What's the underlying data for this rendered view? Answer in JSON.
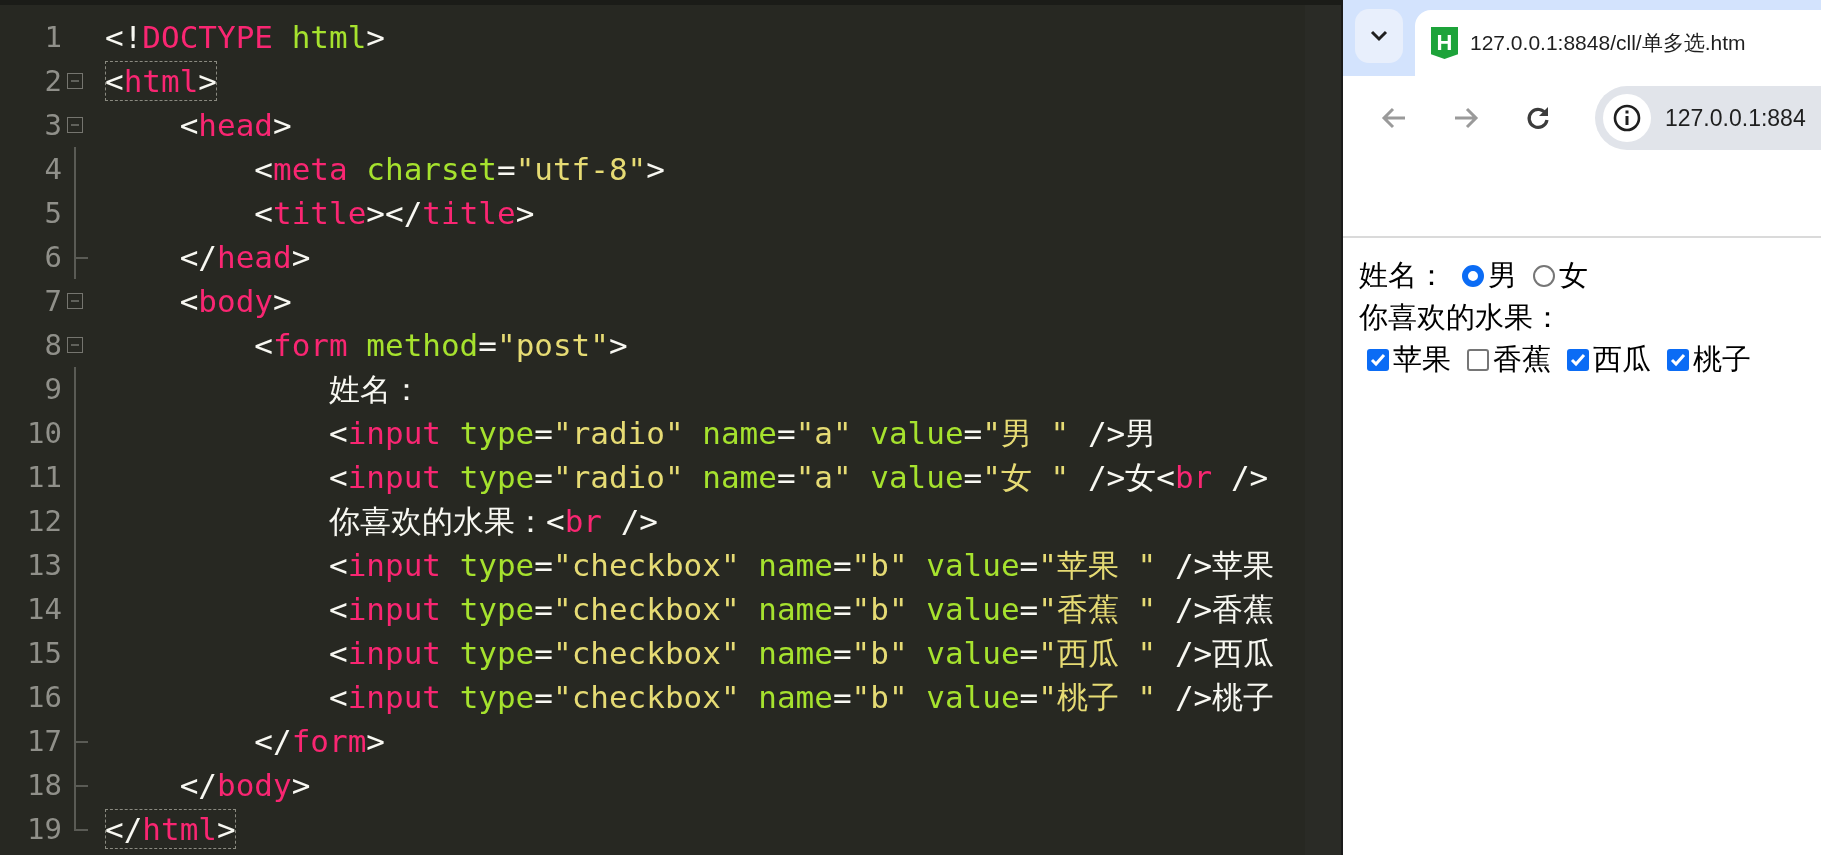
{
  "editor": {
    "lines": [
      {
        "number": "1",
        "kind": "none",
        "matched": false,
        "tokens": [
          {
            "t": "<!",
            "kind": "p"
          },
          {
            "t": "DOCTYPE",
            "kind": "tag"
          },
          {
            "t": " html",
            "kind": "attr"
          },
          {
            "t": ">",
            "kind": "p"
          }
        ]
      },
      {
        "number": "2",
        "kind": "open",
        "matched": true,
        "tokens": [
          {
            "t": "<",
            "kind": "p"
          },
          {
            "t": "html",
            "kind": "tag"
          },
          {
            "t": ">",
            "kind": "p"
          }
        ]
      },
      {
        "number": "3",
        "kind": "open",
        "matched": false,
        "tokens": [
          {
            "t": "    <",
            "kind": "p"
          },
          {
            "t": "head",
            "kind": "tag"
          },
          {
            "t": ">",
            "kind": "p"
          }
        ]
      },
      {
        "number": "4",
        "kind": "inside",
        "matched": false,
        "tokens": [
          {
            "t": "        <",
            "kind": "p"
          },
          {
            "t": "meta",
            "kind": "tag"
          },
          {
            "t": " charset",
            "kind": "attr"
          },
          {
            "t": "=",
            "kind": "p"
          },
          {
            "t": "\"utf-8\"",
            "kind": "str"
          },
          {
            "t": ">",
            "kind": "p"
          }
        ]
      },
      {
        "number": "5",
        "kind": "inside",
        "matched": false,
        "tokens": [
          {
            "t": "        <",
            "kind": "p"
          },
          {
            "t": "title",
            "kind": "tag"
          },
          {
            "t": "></",
            "kind": "p"
          },
          {
            "t": "title",
            "kind": "tag"
          },
          {
            "t": ">",
            "kind": "p"
          }
        ]
      },
      {
        "number": "6",
        "kind": "end",
        "matched": false,
        "tokens": [
          {
            "t": "    </",
            "kind": "p"
          },
          {
            "t": "head",
            "kind": "tag"
          },
          {
            "t": ">",
            "kind": "p"
          }
        ]
      },
      {
        "number": "7",
        "kind": "open",
        "matched": false,
        "tokens": [
          {
            "t": "    <",
            "kind": "p"
          },
          {
            "t": "body",
            "kind": "tag"
          },
          {
            "t": ">",
            "kind": "p"
          }
        ]
      },
      {
        "number": "8",
        "kind": "open",
        "matched": false,
        "tokens": [
          {
            "t": "        <",
            "kind": "p"
          },
          {
            "t": "form",
            "kind": "tag"
          },
          {
            "t": " method",
            "kind": "attr"
          },
          {
            "t": "=",
            "kind": "p"
          },
          {
            "t": "\"post\"",
            "kind": "str"
          },
          {
            "t": ">",
            "kind": "p"
          }
        ]
      },
      {
        "number": "9",
        "kind": "inside",
        "matched": false,
        "tokens": [
          {
            "t": "            姓名：",
            "kind": "p"
          }
        ]
      },
      {
        "number": "10",
        "kind": "inside",
        "matched": false,
        "tokens": [
          {
            "t": "            <",
            "kind": "p"
          },
          {
            "t": "input",
            "kind": "tag"
          },
          {
            "t": " type",
            "kind": "attr"
          },
          {
            "t": "=",
            "kind": "p"
          },
          {
            "t": "\"radio\"",
            "kind": "str"
          },
          {
            "t": " name",
            "kind": "attr"
          },
          {
            "t": "=",
            "kind": "p"
          },
          {
            "t": "\"a\"",
            "kind": "str"
          },
          {
            "t": " value",
            "kind": "attr"
          },
          {
            "t": "=",
            "kind": "p"
          },
          {
            "t": "\"男 \"",
            "kind": "str"
          },
          {
            "t": " />男",
            "kind": "p"
          }
        ]
      },
      {
        "number": "11",
        "kind": "inside",
        "matched": false,
        "tokens": [
          {
            "t": "            <",
            "kind": "p"
          },
          {
            "t": "input",
            "kind": "tag"
          },
          {
            "t": " type",
            "kind": "attr"
          },
          {
            "t": "=",
            "kind": "p"
          },
          {
            "t": "\"radio\"",
            "kind": "str"
          },
          {
            "t": " name",
            "kind": "attr"
          },
          {
            "t": "=",
            "kind": "p"
          },
          {
            "t": "\"a\"",
            "kind": "str"
          },
          {
            "t": " value",
            "kind": "attr"
          },
          {
            "t": "=",
            "kind": "p"
          },
          {
            "t": "\"女 \"",
            "kind": "str"
          },
          {
            "t": " />女<",
            "kind": "p"
          },
          {
            "t": "br",
            "kind": "tag"
          },
          {
            "t": " />",
            "kind": "p"
          }
        ]
      },
      {
        "number": "12",
        "kind": "inside",
        "matched": false,
        "tokens": [
          {
            "t": "            你喜欢的水果：<",
            "kind": "p"
          },
          {
            "t": "br",
            "kind": "tag"
          },
          {
            "t": " />",
            "kind": "p"
          }
        ]
      },
      {
        "number": "13",
        "kind": "inside",
        "matched": false,
        "tokens": [
          {
            "t": "            <",
            "kind": "p"
          },
          {
            "t": "input",
            "kind": "tag"
          },
          {
            "t": " type",
            "kind": "attr"
          },
          {
            "t": "=",
            "kind": "p"
          },
          {
            "t": "\"checkbox\"",
            "kind": "str"
          },
          {
            "t": " name",
            "kind": "attr"
          },
          {
            "t": "=",
            "kind": "p"
          },
          {
            "t": "\"b\"",
            "kind": "str"
          },
          {
            "t": " value",
            "kind": "attr"
          },
          {
            "t": "=",
            "kind": "p"
          },
          {
            "t": "\"苹果 \"",
            "kind": "str"
          },
          {
            "t": " />苹果",
            "kind": "p"
          }
        ]
      },
      {
        "number": "14",
        "kind": "inside",
        "matched": false,
        "tokens": [
          {
            "t": "            <",
            "kind": "p"
          },
          {
            "t": "input",
            "kind": "tag"
          },
          {
            "t": " type",
            "kind": "attr"
          },
          {
            "t": "=",
            "kind": "p"
          },
          {
            "t": "\"checkbox\"",
            "kind": "str"
          },
          {
            "t": " name",
            "kind": "attr"
          },
          {
            "t": "=",
            "kind": "p"
          },
          {
            "t": "\"b\"",
            "kind": "str"
          },
          {
            "t": " value",
            "kind": "attr"
          },
          {
            "t": "=",
            "kind": "p"
          },
          {
            "t": "\"香蕉 \"",
            "kind": "str"
          },
          {
            "t": " />香蕉",
            "kind": "p"
          }
        ]
      },
      {
        "number": "15",
        "kind": "inside",
        "matched": false,
        "tokens": [
          {
            "t": "            <",
            "kind": "p"
          },
          {
            "t": "input",
            "kind": "tag"
          },
          {
            "t": " type",
            "kind": "attr"
          },
          {
            "t": "=",
            "kind": "p"
          },
          {
            "t": "\"checkbox\"",
            "kind": "str"
          },
          {
            "t": " name",
            "kind": "attr"
          },
          {
            "t": "=",
            "kind": "p"
          },
          {
            "t": "\"b\"",
            "kind": "str"
          },
          {
            "t": " value",
            "kind": "attr"
          },
          {
            "t": "=",
            "kind": "p"
          },
          {
            "t": "\"西瓜 \"",
            "kind": "str"
          },
          {
            "t": " />西瓜",
            "kind": "p"
          }
        ]
      },
      {
        "number": "16",
        "kind": "inside",
        "matched": false,
        "tokens": [
          {
            "t": "            <",
            "kind": "p"
          },
          {
            "t": "input",
            "kind": "tag"
          },
          {
            "t": " type",
            "kind": "attr"
          },
          {
            "t": "=",
            "kind": "p"
          },
          {
            "t": "\"checkbox\"",
            "kind": "str"
          },
          {
            "t": " name",
            "kind": "attr"
          },
          {
            "t": "=",
            "kind": "p"
          },
          {
            "t": "\"b\"",
            "kind": "str"
          },
          {
            "t": " value",
            "kind": "attr"
          },
          {
            "t": "=",
            "kind": "p"
          },
          {
            "t": "\"桃子 \"",
            "kind": "str"
          },
          {
            "t": " />桃子",
            "kind": "p"
          }
        ]
      },
      {
        "number": "17",
        "kind": "end",
        "matched": false,
        "tokens": [
          {
            "t": "        </",
            "kind": "p"
          },
          {
            "t": "form",
            "kind": "tag"
          },
          {
            "t": ">",
            "kind": "p"
          }
        ]
      },
      {
        "number": "18",
        "kind": "end",
        "matched": false,
        "tokens": [
          {
            "t": "    </",
            "kind": "p"
          },
          {
            "t": "body",
            "kind": "tag"
          },
          {
            "t": ">",
            "kind": "p"
          }
        ]
      },
      {
        "number": "19",
        "kind": "last",
        "matched": true,
        "tokens": [
          {
            "t": "</",
            "kind": "p"
          },
          {
            "t": "html",
            "kind": "tag"
          },
          {
            "t": ">",
            "kind": "p"
          }
        ]
      }
    ]
  },
  "browser": {
    "tab": {
      "favicon_text": "H",
      "title": "127.0.0.1:8848/cll/单多选.htm"
    },
    "address_bar": {
      "value": "127.0.0.1:884"
    },
    "page": {
      "name_label": "姓名：",
      "fruits_label": "你喜欢的水果：",
      "radios": [
        {
          "label": "男",
          "selected": true
        },
        {
          "label": "女",
          "selected": false
        }
      ],
      "checkboxes": [
        {
          "label": "苹果",
          "checked": true
        },
        {
          "label": "香蕉",
          "checked": false
        },
        {
          "label": "西瓜",
          "checked": true
        },
        {
          "label": "桃子",
          "checked": true
        }
      ]
    }
  }
}
